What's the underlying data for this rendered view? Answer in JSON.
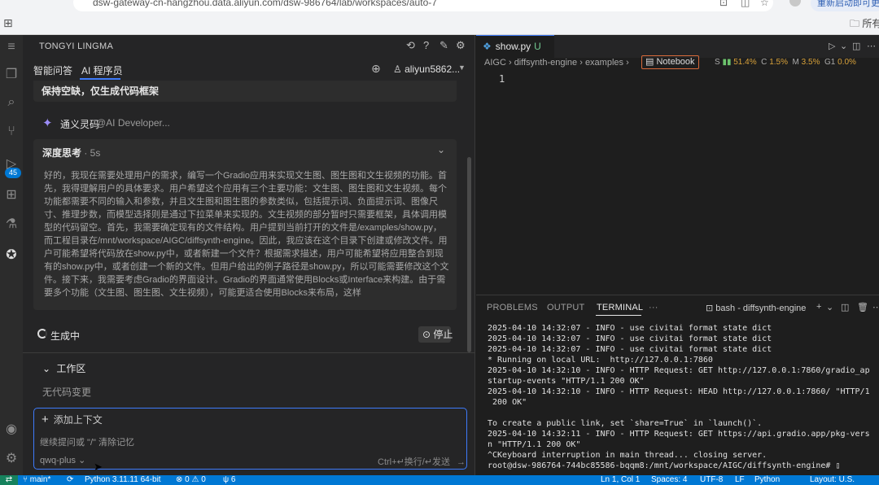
{
  "browser": {
    "url": "dsw-gateway-cn-hangzhou.data.aliyun.com/dsw-986764/lab/workspaces/auto-7",
    "restart_label": "重新启动即可更新",
    "bookmark_folder": "所有书签"
  },
  "activity_bar": {
    "badge": "45"
  },
  "tongyi": {
    "title": "TONGYI LINGMA",
    "tabs": [
      "智能问答",
      "AI 程序员"
    ],
    "user": "aliyun5862...",
    "prev_message": "保持空缺，仅生成代码框架",
    "assistant_name": "通义灵码",
    "assistant_mention": "@AI Developer...",
    "thinking": {
      "label": "深度思考",
      "time": " · 5s",
      "text": "好的，我现在需要处理用户的需求，编写一个Gradio应用来实现文生图、图生图和文生视频的功能。首先，我得理解用户的具体要求。用户希望这个应用有三个主要功能：文生图、图生图和文生视频。每个功能都需要不同的输入和参数，并且文生图和图生图的参数类似，包括提示词、负面提示词、图像尺寸、推理步数，而模型选择则是通过下拉菜单来实现的。文生视频的部分暂时只需要框架，具体调用模型的代码留空。首先，我需要确定现有的文件结构。用户提到当前打开的文件是/examples/show.py，而工程目录在/mnt/workspace/AIGC/diffsynth-engine。因此，我应该在这个目录下创建或修改文件。用户可能希望将代码放在show.py中，或者新建一个文件？根据需求描述，用户可能希望将应用整合到现有的show.py中，或者创建一个新的文件。但用户给出的例子路径是show.py，所以可能需要修改这个文件。接下来，我需要考虑Gradio的界面设计。Gradio的界面通常使用Blocks或Interface来构建。由于需要多个功能（文生图、图生图、文生视频），可能更适合使用Blocks来布局，这样"
    },
    "generating_label": "生成中",
    "stop_label": "停止",
    "workspace_label": "工作区",
    "workspace_status": "无代码变更",
    "input": {
      "add_context": "添加上下文",
      "placeholder": "继续提问或 \"/\" 清除记忆",
      "model": "qwq-plus",
      "send_hint": "Ctrl+↵换行/↵发送"
    }
  },
  "editor": {
    "tab_name": "show.py",
    "tab_modified": "U",
    "breadcrumb": [
      "AIGC",
      "diffsynth-engine",
      "examples"
    ],
    "notebook_label": "Notebook",
    "stats": [
      {
        "key": "S",
        "value": "51.4%"
      },
      {
        "key": "C",
        "value": "1.5%"
      },
      {
        "key": "M",
        "value": "3.5%"
      },
      {
        "key": "G1",
        "value": "0.0%"
      }
    ],
    "line_number": "1"
  },
  "panel": {
    "tabs": [
      "PROBLEMS",
      "OUTPUT",
      "TERMINAL"
    ],
    "more": "···",
    "session": "bash - diffsynth-engine",
    "terminal_lines": [
      "2025-04-10 14:32:07 - INFO - use civitai format state dict",
      "2025-04-10 14:32:07 - INFO - use civitai format state dict",
      "2025-04-10 14:32:07 - INFO - use civitai format state dict",
      "* Running on local URL:  http://127.0.0.1:7860",
      "2025-04-10 14:32:10 - INFO - HTTP Request: GET http://127.0.0.1:7860/gradio_ap",
      "startup-events \"HTTP/1.1 200 OK\"",
      "2025-04-10 14:32:10 - INFO - HTTP Request: HEAD http://127.0.0.1:7860/ \"HTTP/1",
      " 200 OK\"",
      "",
      "To create a public link, set `share=True` in `launch()`.",
      "2025-04-10 14:32:11 - INFO - HTTP Request: GET https://api.gradio.app/pkg-vers",
      "n \"HTTP/1.1 200 OK\"",
      "^CKeyboard interruption in main thread... closing server.",
      "root@dsw-986764-744bc85586-bqqm8:/mnt/workspace/AIGC/diffsynth-engine# ▯"
    ]
  },
  "statusbar": {
    "branch": "main*",
    "python": "Python 3.11.11 64-bit",
    "problems": "⊗ 0 ⚠ 0",
    "ports": "6",
    "position": "Ln 1, Col 1",
    "spaces": "Spaces: 4",
    "encoding": "UTF-8",
    "eol": "LF",
    "language": "Python",
    "layout": "Layout: U.S."
  }
}
